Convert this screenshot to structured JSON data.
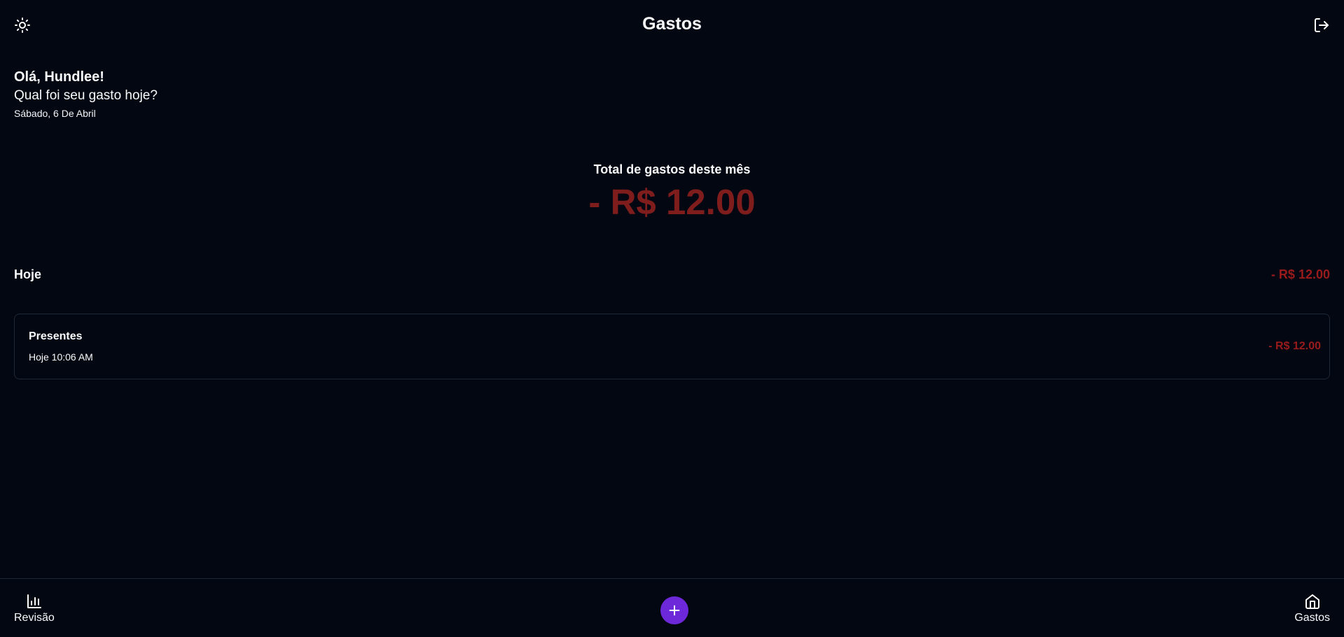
{
  "header": {
    "title": "Gastos",
    "theme_icon": "sun-icon",
    "logout_icon": "logout-icon"
  },
  "greeting": {
    "name": "Olá, Hundlee!",
    "question": "Qual foi seu gasto hoje?",
    "date": "Sábado, 6 De Abril"
  },
  "summary": {
    "label": "Total de gastos deste mês",
    "value": "- R$ 12.00"
  },
  "day_group": {
    "label": "Hoje",
    "total": "- R$ 12.00",
    "expenses": [
      {
        "category": "Presentes",
        "time": "Hoje 10:06 AM",
        "amount": "- R$ 12.00"
      }
    ]
  },
  "nav": {
    "review_label": "Revisão",
    "review_icon": "bar-chart-icon",
    "gastos_label": "Gastos",
    "gastos_icon": "home-icon",
    "add_icon": "plus-icon"
  },
  "colors": {
    "background": "#030712",
    "negative": "#991b1b",
    "accent": "#6d28d9",
    "border": "#1f2937"
  }
}
